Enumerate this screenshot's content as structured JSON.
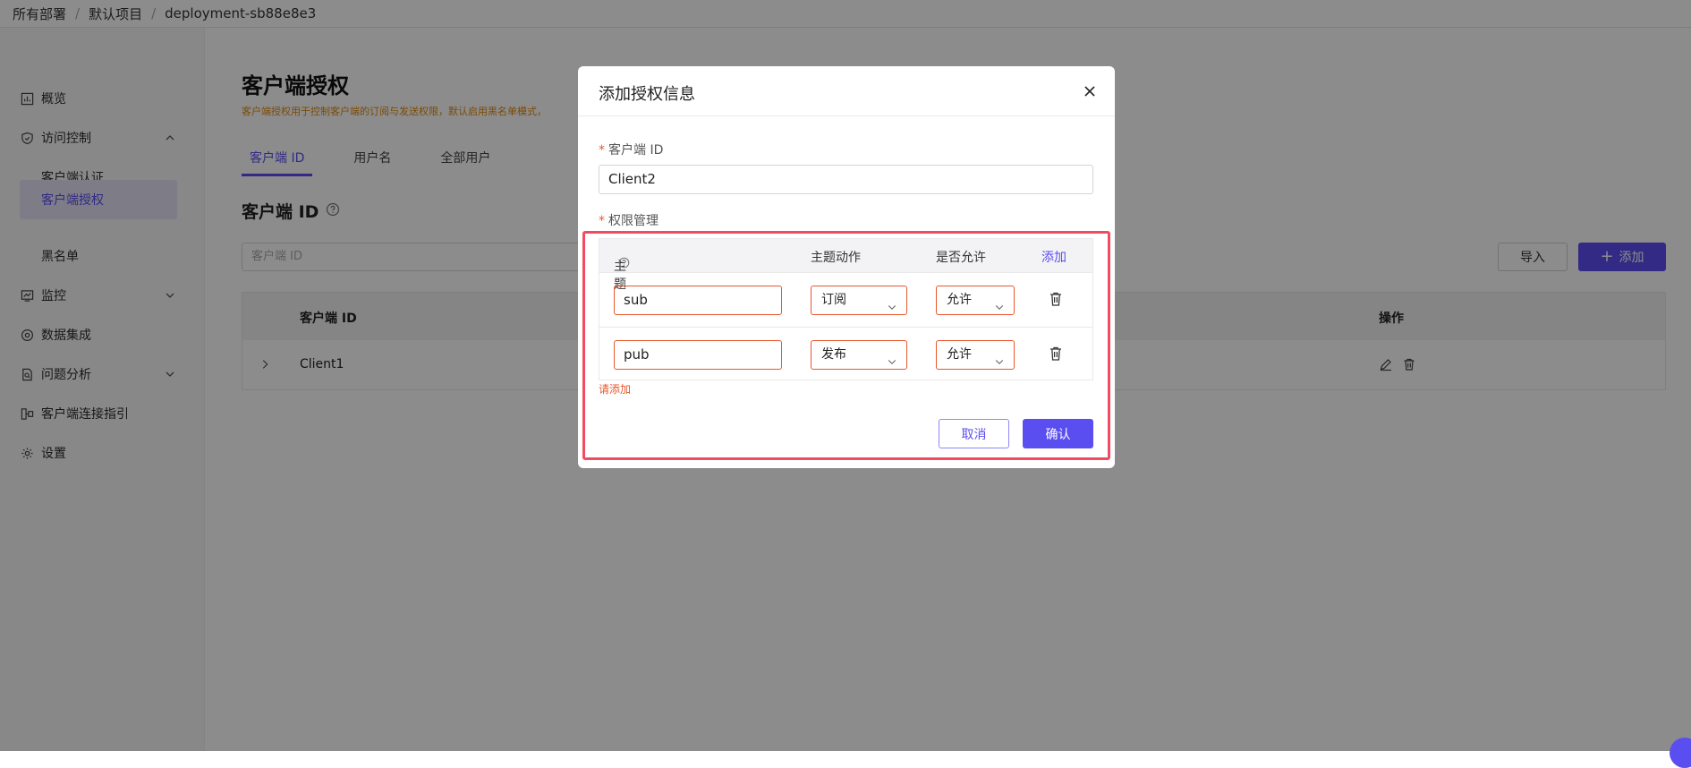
{
  "breadcrumb": [
    "所有部署",
    "默认项目",
    "deployment-sb88e8e3"
  ],
  "sidebar": {
    "items": [
      {
        "label": "概览",
        "icon": "overview-icon"
      },
      {
        "label": "访问控制",
        "icon": "shield-icon",
        "expanded": true
      },
      {
        "label": "客户端认证"
      },
      {
        "label": "客户端授权",
        "active": true
      },
      {
        "label": "黑名单"
      },
      {
        "label": "监控",
        "icon": "monitor-icon"
      },
      {
        "label": "数据集成",
        "icon": "data-integration-icon"
      },
      {
        "label": "问题分析",
        "icon": "diagnose-icon"
      },
      {
        "label": "客户端连接指引",
        "icon": "connect-guide-icon"
      },
      {
        "label": "设置",
        "icon": "gear-icon"
      }
    ]
  },
  "main": {
    "title": "客户端授权",
    "description": "客户端授权用于控制客户端的订阅与发送权限，默认启用黑名单模式，",
    "tabs": [
      "客户端 ID",
      "用户名",
      "全部用户"
    ],
    "section_title": "客户端 ID",
    "filter_placeholder": "客户端 ID",
    "import_label": "导入",
    "add_label": "添加",
    "table": {
      "headers": [
        "客户端 ID",
        "操作"
      ],
      "rows": [
        {
          "client_id": "Client1"
        }
      ]
    }
  },
  "modal": {
    "title": "添加授权信息",
    "client_id_label": "客户端 ID",
    "client_id_value": "Client2",
    "perm_label": "权限管理",
    "perm_headers": {
      "topic": "主题",
      "action": "主题动作",
      "allow": "是否允许",
      "add": "添加"
    },
    "perm_rows": [
      {
        "topic": "sub",
        "action": "订阅",
        "allow": "允许"
      },
      {
        "topic": "pub",
        "action": "发布",
        "allow": "允许"
      }
    ],
    "error_text": "请添加",
    "cancel_label": "取消",
    "confirm_label": "确认"
  },
  "colors": {
    "accent": "#5b4ef0",
    "error": "#e8582c",
    "highlight": "#f24a61"
  }
}
